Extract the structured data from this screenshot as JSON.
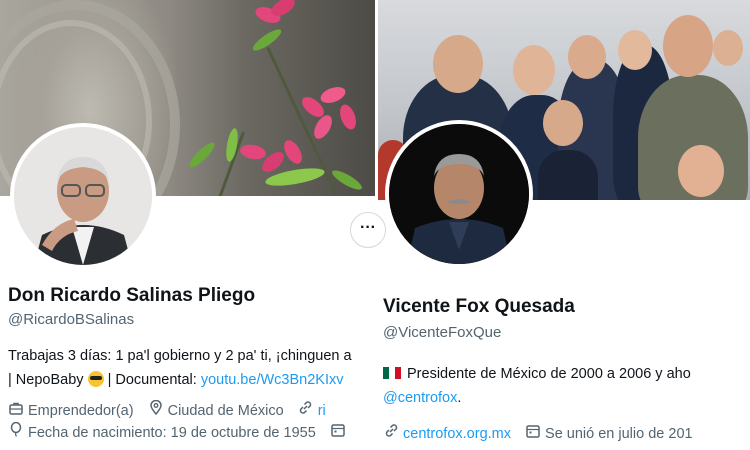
{
  "left_profile": {
    "display_name": "Don Ricardo Salinas Pliego",
    "handle": "@RicardoBSalinas",
    "bio_line1": "Trabajas 3 días: 1 pa'l gobierno y 2 pa' ti, ¡chinguen a",
    "bio_line2_prefix": "| NepoBaby",
    "bio_line2_mid": " | Documental: ",
    "bio_link": "youtu.be/Wc3Bn2KIxv",
    "profession": "Emprendedor(a)",
    "location": "Ciudad de México",
    "website_partial": "ri",
    "birthdate": "Fecha de nacimiento: 19 de octubre de 1955",
    "icons": {
      "profession": "briefcase-icon",
      "location": "location-pin-icon",
      "website": "link-icon",
      "birthday": "balloon-icon",
      "calendar": "calendar-icon",
      "more": "more-options-icon"
    }
  },
  "right_profile": {
    "display_name": "Vicente Fox Quesada",
    "handle": "@VicenteFoxQue",
    "bio_line1": "Presidente de México de 2000 a 2006 y aho",
    "bio_link": "@centrofox",
    "bio_link_suffix": ".",
    "website": "centrofox.org.mx",
    "joined": "Se unió en julio de 201",
    "icons": {
      "flag": "mexico-flag-icon",
      "website": "link-icon",
      "calendar": "calendar-icon"
    }
  },
  "colors": {
    "link": "#1d9bf0",
    "secondary_text": "#536471",
    "primary_text": "#0f1419"
  }
}
